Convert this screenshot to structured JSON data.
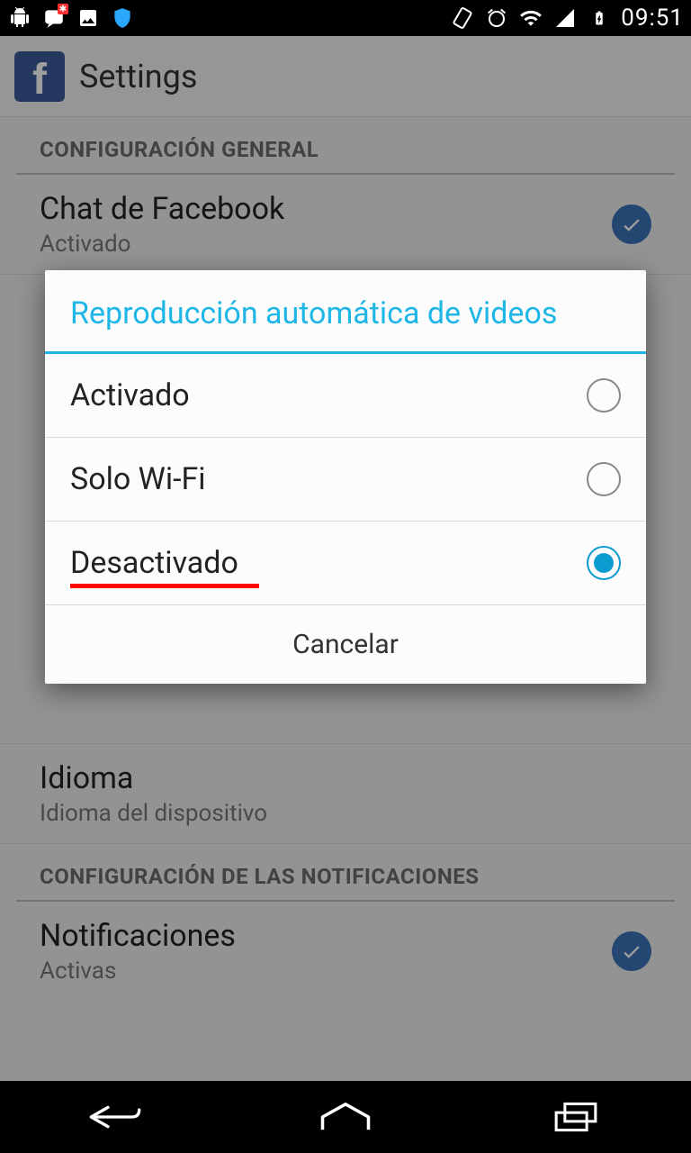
{
  "status": {
    "clock": "09:51"
  },
  "appbar": {
    "title": "Settings"
  },
  "sections": {
    "general_header": "CONFIGURACIÓN GENERAL",
    "notifications_header": "CONFIGURACIÓN DE LAS NOTIFICACIONES"
  },
  "rows": {
    "chat": {
      "title": "Chat de Facebook",
      "sub": "Activado"
    },
    "idioma": {
      "title": "Idioma",
      "sub": "Idioma del dispositivo"
    },
    "notif": {
      "title": "Notificaciones",
      "sub": "Activas"
    }
  },
  "dialog": {
    "title": "Reproducción automática de videos",
    "options": {
      "on": "Activado",
      "wifi": "Solo Wi-Fi",
      "off": "Desactivado"
    },
    "cancel": "Cancelar",
    "selected": "off"
  }
}
